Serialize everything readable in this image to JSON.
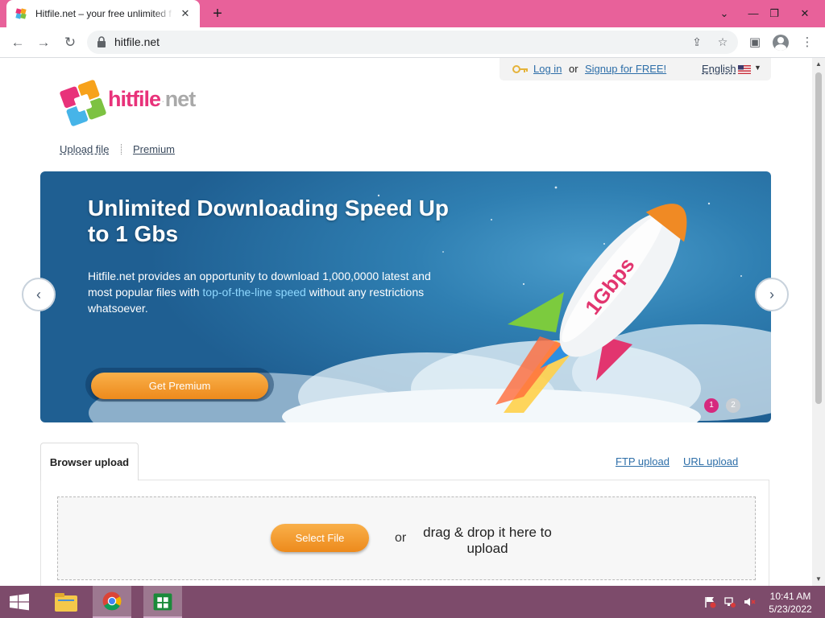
{
  "browser": {
    "tab_title": "Hitfile.net – your free unlimited f",
    "url": "hitfile.net"
  },
  "site": {
    "logo": "hitfile.net",
    "login": "Log in",
    "or": "or",
    "signup": "Signup for FREE!",
    "language": "English",
    "nav": [
      "Upload file",
      "Premium"
    ]
  },
  "banner": {
    "title": "Unlimited Downloading Speed Up to 1 Gbs",
    "desc_before": "Hitfile.net provides an opportunity to download 1,000,0000 latest and most popular files with ",
    "desc_highlight": "top-of-the-line speed",
    "desc_after": " without any restrictions whatsoever.",
    "cta": "Get Premium",
    "rocket_label": "1Gbps",
    "slides": [
      "1",
      "2"
    ]
  },
  "upload": {
    "tab": "Browser upload",
    "ftp": "FTP upload",
    "url": "URL upload",
    "select": "Select File",
    "or": "or",
    "drag": "drag & drop it here to upload"
  },
  "taskbar": {
    "time": "10:41 AM",
    "date": "5/23/2022"
  },
  "colors": {
    "tabstrip": "#e8619a",
    "taskbar": "#7d4b6b",
    "accent_orange": "#ed8a1c",
    "link": "#2d6ea8",
    "pink": "#d6297e"
  }
}
